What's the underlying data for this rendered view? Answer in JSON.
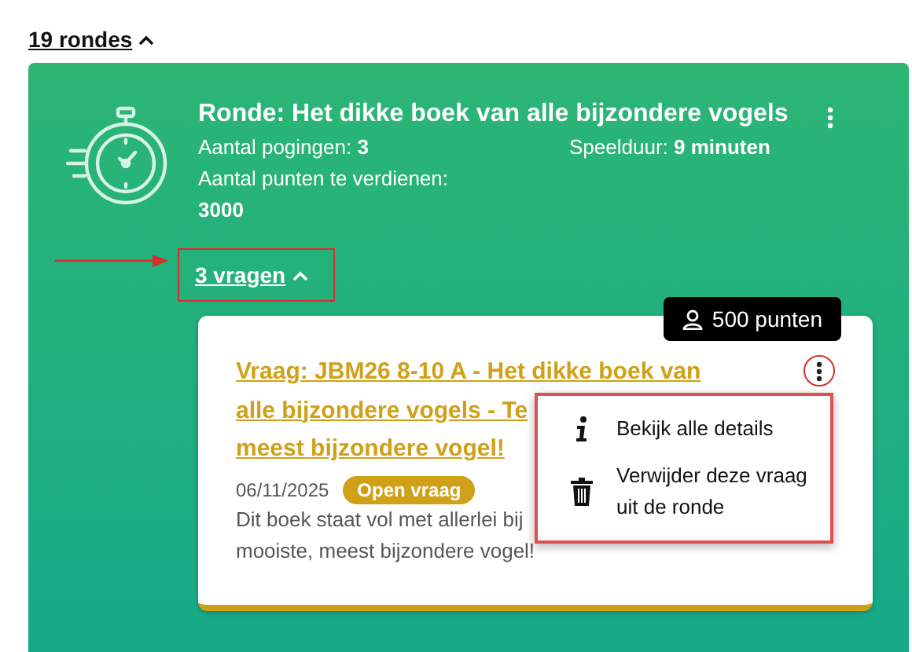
{
  "rounds_toggle": {
    "label": "19 rondes",
    "expanded": true
  },
  "round": {
    "title": "Ronde: Het dikke boek van alle bijzondere vogels",
    "stats": [
      {
        "label": "Aantal pogingen:",
        "value": "3"
      },
      {
        "label": "Speelduur:",
        "value": "9 minuten"
      },
      {
        "label": "Aantal punten te verdienen:",
        "value": "3000"
      }
    ],
    "questions_toggle": {
      "label": "3 vragen",
      "expanded": true
    },
    "questions": [
      {
        "points": "500 punten",
        "title_lines": [
          "Vraag: JBM26 8-10 A - Het dikke boek van",
          "alle bijzondere vogels - Te",
          "meest bijzondere vogel!"
        ],
        "date": "06/11/2025",
        "tag": "Open vraag",
        "description_lines": [
          "Dit boek staat vol met allerlei bij",
          "mooiste, meest bijzondere vogel!"
        ],
        "menu": {
          "open": true,
          "items": [
            {
              "kind": "info",
              "label": "Bekijk alle details"
            },
            {
              "kind": "delete",
              "label": "Verwijder deze vraag uit de ronde"
            }
          ]
        }
      }
    ]
  }
}
